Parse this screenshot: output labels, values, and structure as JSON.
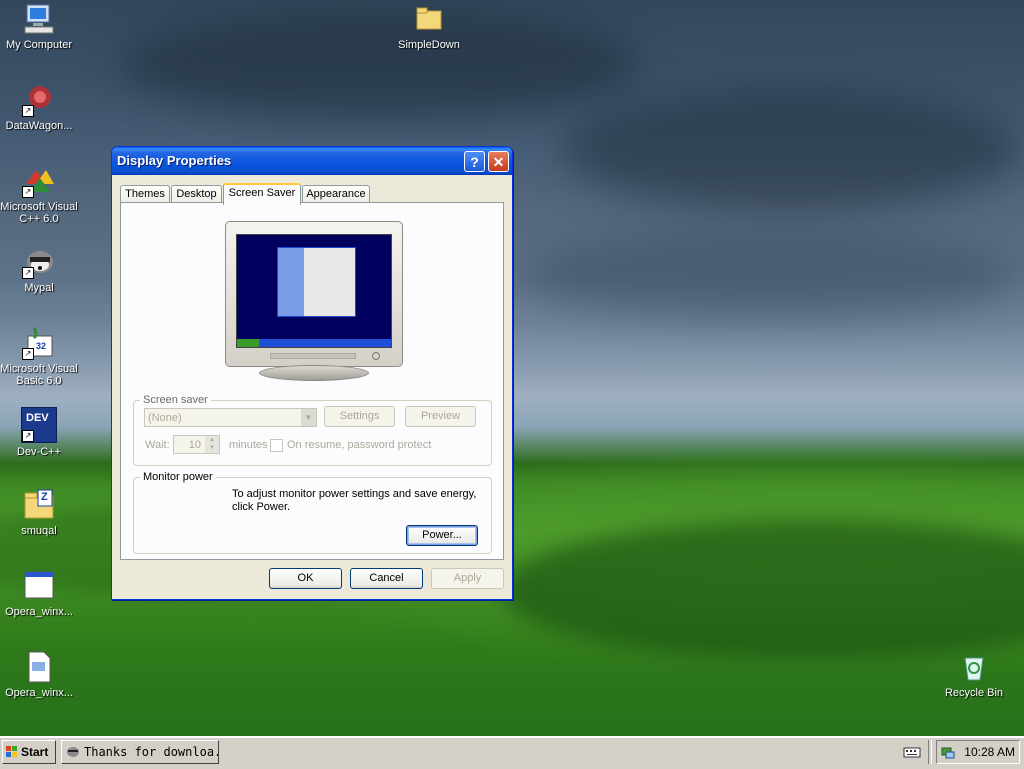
{
  "desktop": {
    "icons": [
      {
        "label": "My Computer"
      },
      {
        "label": "DataWagon..."
      },
      {
        "label": "Microsoft Visual C++ 6.0"
      },
      {
        "label": "Mypal"
      },
      {
        "label": "Microsoft Visual Basic 6.0"
      },
      {
        "label": "Dev-C++"
      },
      {
        "label": "smuqal"
      },
      {
        "label": "Opera_winx..."
      },
      {
        "label": "Opera_winx..."
      },
      {
        "label": "SimpleDown"
      },
      {
        "label": "Recycle Bin"
      }
    ],
    "icon_glyphs": {
      "dev": "DEV",
      "zip": "Z",
      "vb_version": "32"
    }
  },
  "dialog": {
    "title": "Display Properties",
    "help_glyph": "?",
    "close_glyph": "✕",
    "tabs": [
      {
        "label": "Themes",
        "active": false
      },
      {
        "label": "Desktop",
        "active": false
      },
      {
        "label": "Screen Saver",
        "active": true
      },
      {
        "label": "Appearance",
        "active": false
      }
    ],
    "screen_saver": {
      "group_label": "Screen saver",
      "selected": "(None)",
      "settings_label": "Settings",
      "preview_label": "Preview",
      "wait_label": "Wait:",
      "wait_value": "10",
      "minutes_label": "minutes",
      "resume_label": "On resume, password protect",
      "resume_checked": false,
      "enabled": false
    },
    "monitor_power": {
      "group_label": "Monitor power",
      "description": "To adjust monitor power settings and save energy, click Power.",
      "power_label": "Power..."
    },
    "buttons": {
      "ok": "OK",
      "cancel": "Cancel",
      "apply": "Apply",
      "apply_enabled": false
    }
  },
  "taskbar": {
    "start_label": "Start",
    "items": [
      {
        "label": "Thanks for downloa..."
      }
    ],
    "clock": "10:28 AM"
  },
  "colors": {
    "title_blue": "#0855dd",
    "dialog_bg": "#ece9d8",
    "active_tab_accent": "#ffc83c",
    "close_red": "#c43c1b",
    "taskbar_gray": "#d4d0c8"
  }
}
